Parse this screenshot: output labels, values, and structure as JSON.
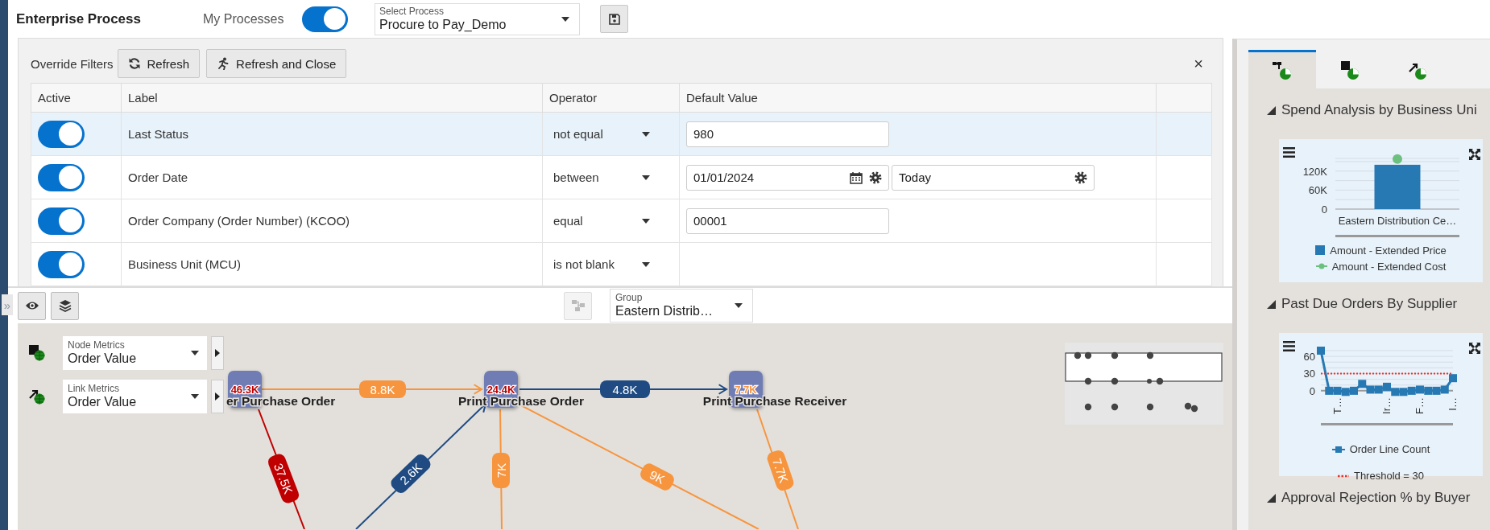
{
  "header": {
    "title": "Enterprise Process",
    "my_processes": {
      "label": "My Processes",
      "on": true
    },
    "process_select": {
      "label": "Select Process",
      "value": "Procure to Pay_Demo"
    }
  },
  "filters": {
    "label": "Override Filters",
    "buttons": [
      {
        "kind": "refresh",
        "label": "Refresh"
      },
      {
        "kind": "run",
        "label": "Refresh and Close"
      }
    ],
    "close": "×",
    "columns": [
      "Active",
      "Label",
      "Operator",
      "Default Value"
    ],
    "rows": [
      {
        "selected": true,
        "active": true,
        "label": "Last Status",
        "operator": "not equal",
        "values": [
          {
            "kind": "text",
            "value": "980"
          }
        ]
      },
      {
        "selected": false,
        "active": true,
        "label": "Order Date",
        "operator": "between",
        "values": [
          {
            "kind": "date",
            "value": "01/01/2024"
          },
          {
            "kind": "relative",
            "value": "Today"
          }
        ]
      },
      {
        "selected": false,
        "active": true,
        "label": "Order Company (Order Number) (KCOO)",
        "operator": "equal",
        "values": [
          {
            "kind": "text",
            "value": "00001"
          }
        ]
      },
      {
        "selected": false,
        "active": true,
        "label": "Business Unit (MCU)",
        "operator": "is not blank"
      }
    ]
  },
  "collapse_handle": "»",
  "toolbar": {
    "group": {
      "label": "Group",
      "value": "Eastern Distrib…"
    }
  },
  "graph": {
    "node_metrics": {
      "label": "Node Metrics",
      "value": "Order Value"
    },
    "link_metrics": {
      "label": "Link Metrics",
      "value": "Order Value"
    },
    "nodes": [
      {
        "label": "er Purchase Order",
        "value": "46.3K",
        "color": "#c00000"
      },
      {
        "label": "Print Purchase Order",
        "value": "24.4K",
        "color": "#c00000"
      },
      {
        "label": "Print Purchase Receiver",
        "value": "7.7K",
        "color": "#f7953f"
      }
    ],
    "links": [
      {
        "label": "8.8K",
        "color": "#f7953f",
        "arrow": true
      },
      {
        "label": "4.8K",
        "color": "#1f4b82",
        "arrow": true
      },
      {
        "label": "37.5K",
        "color": "#c00000",
        "arrow": false
      },
      {
        "label": "2.6K",
        "color": "#1f4b82",
        "arrow": true
      },
      {
        "label": "7K",
        "color": "#f7953f",
        "arrow": false
      },
      {
        "label": "9K",
        "color": "#f7953f",
        "arrow": false
      },
      {
        "label": "7.7K",
        "color": "#f7953f",
        "arrow": false
      }
    ]
  },
  "side_panel": {
    "tabs": [
      {
        "kind": "flow",
        "selected": true
      },
      {
        "kind": "node",
        "selected": false
      },
      {
        "kind": "link",
        "selected": false
      }
    ],
    "sections": [
      {
        "title": "Spend Analysis by Business Uni",
        "expanded": true,
        "chart_data": {
          "type": "bar",
          "categories": [
            "Eastern Distribution Ce…"
          ],
          "ylim": [
            0,
            160000
          ],
          "yticks": [
            {
              "value": 0,
              "label": "0"
            },
            {
              "value": 60000,
              "label": "60K"
            },
            {
              "value": 120000,
              "label": "120K"
            }
          ],
          "series": [
            {
              "name": "Amount - Extended Price",
              "color": "#2779b4",
              "values": [
                140000
              ]
            },
            {
              "name": "Amount - Extended Cost",
              "color": "#6cc07f",
              "type": "line",
              "marker": "circle",
              "values": [
                158000
              ]
            }
          ]
        }
      },
      {
        "title": "Past Due Orders By Supplier",
        "expanded": true,
        "chart_data": {
          "type": "line",
          "ylim": [
            -3,
            70
          ],
          "yticks": [
            {
              "value": 0,
              "label": "0"
            },
            {
              "value": 30,
              "label": "30"
            },
            {
              "value": 60,
              "label": "60"
            }
          ],
          "categories": [
            null,
            null,
            "T…",
            null,
            null,
            null,
            null,
            null,
            "Ir…",
            null,
            null,
            null,
            "F…",
            null,
            null,
            null,
            "I…"
          ],
          "series": [
            {
              "name": "Order Line Count",
              "color": "#2779b4",
              "marker": "square",
              "values": [
                70,
                0,
                0,
                -2,
                0,
                12,
                2,
                2,
                7,
                -2,
                -2,
                0,
                2,
                0,
                0,
                2,
                22
              ]
            },
            {
              "name": "Threshold = 30",
              "color": "#e8332a",
              "line_style": "dotted",
              "values": [
                30,
                30,
                30,
                30,
                30,
                30,
                30,
                30,
                30,
                30,
                30,
                30,
                30,
                30,
                30,
                30,
                30
              ]
            }
          ]
        }
      },
      {
        "title": "Approval Rejection % by Buyer",
        "expanded": true
      }
    ]
  }
}
